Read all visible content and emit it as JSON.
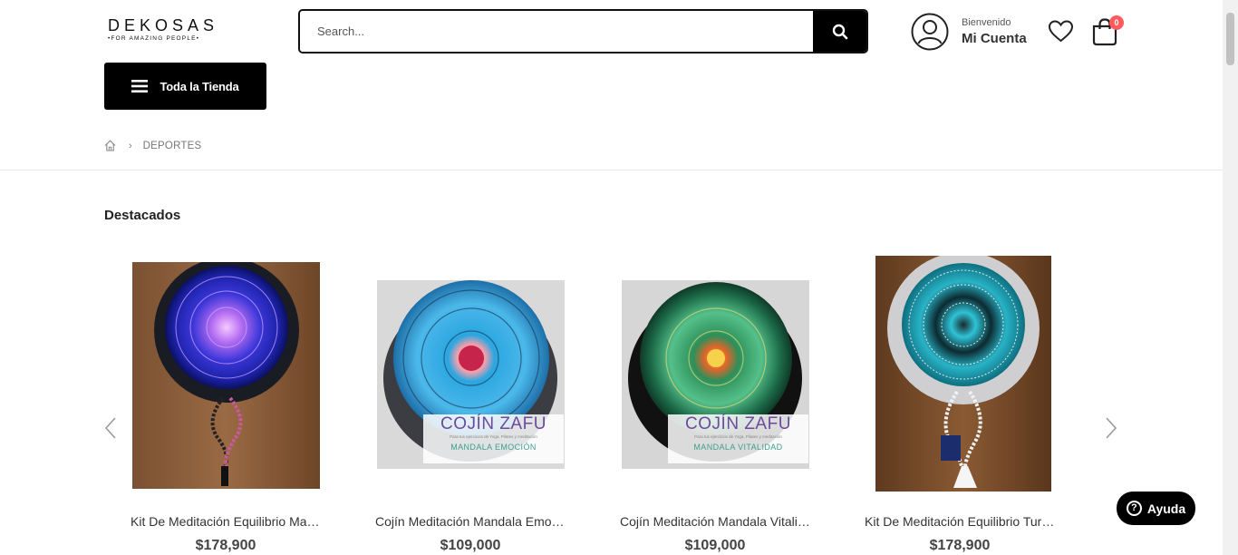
{
  "brand": {
    "name": "DEKOSAS",
    "tagline": "•FOR AMAZING PEOPLE•"
  },
  "search": {
    "placeholder": "Search..."
  },
  "account": {
    "welcome": "Bienvenido",
    "label": "Mi Cuenta"
  },
  "cart": {
    "count": "0"
  },
  "menu": {
    "store_label": "Toda la Tienda"
  },
  "breadcrumb": {
    "current": "DEPORTES"
  },
  "section": {
    "title": "Destacados"
  },
  "products": [
    {
      "name": "Kit De Meditación Equilibrio Mandala",
      "price": "$178,900"
    },
    {
      "name": "Cojín Meditación Mandala Emoción",
      "price": "$109,000",
      "caption": {
        "title": "COJÍN ZAFU",
        "small": "Para tus ejercicios de Yoga, Pilates y meditación",
        "subtitle": "MANDALA EMOCIÓN"
      }
    },
    {
      "name": "Cojín Meditación Mandala Vitalidad",
      "price": "$109,000",
      "caption": {
        "title": "COJÍN ZAFU",
        "small": "Para tus ejercicios de Yoga, Pilates y meditación",
        "subtitle": "MANDALA VITALIDAD"
      }
    },
    {
      "name": "Kit De Meditación Equilibrio Turquesa",
      "price": "$178,900"
    }
  ],
  "help": {
    "label": "Ayuda"
  },
  "colors": {
    "accent": "#000000",
    "badge": "#ff5b5b",
    "caption_title": "#6b4a9c",
    "caption_sub": "#3f9e8e"
  }
}
